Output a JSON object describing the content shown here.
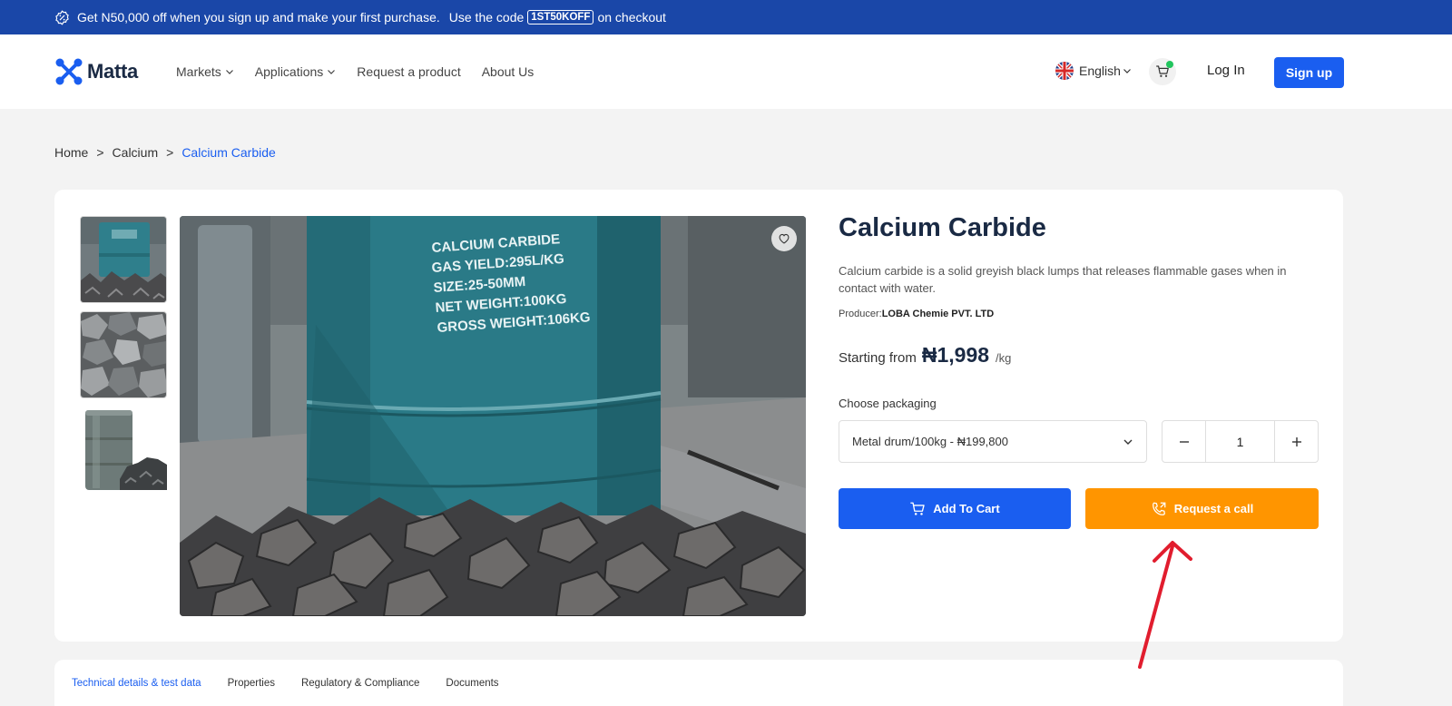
{
  "promo": {
    "text": "Get N50,000 off when you sign up and make your first purchase.",
    "code_prefix": "Use the code",
    "code": "1ST50KOFF",
    "code_suffix": "on checkout"
  },
  "header": {
    "brand": "Matta",
    "nav": [
      "Markets",
      "Applications",
      "Request a product",
      "About Us"
    ],
    "language": "English",
    "login": "Log In",
    "signup": "Sign up"
  },
  "breadcrumb": [
    "Home",
    "Calcium",
    "Calcium Carbide"
  ],
  "product": {
    "title": "Calcium Carbide",
    "description": "Calcium carbide is a solid greyish black lumps that releases flammable gases when in contact with water.",
    "producer_label": "Producer:",
    "producer": "LOBA Chemie PVT. LTD",
    "price_prefix": "Starting from",
    "price": "₦1,998",
    "price_unit": "/kg",
    "packaging_label": "Choose packaging",
    "packaging_selected": "Metal drum/100kg - ₦199,800",
    "quantity": "1",
    "add_to_cart": "Add To Cart",
    "request_call": "Request a call",
    "drum_label": [
      "CALCIUM CARBIDE",
      "GAS YIELD:295L/KG",
      "SIZE:25-50MM",
      "NET WEIGHT:100KG",
      "GROSS WEIGHT:106KG"
    ]
  },
  "tabs": [
    "Technical details & test data",
    "Properties",
    "Regulatory & Compliance",
    "Documents"
  ],
  "colors": {
    "promo_bg": "#1a47a8",
    "primary": "#1a5ef0",
    "orange": "#ff9500",
    "arrow": "#e11d2e"
  }
}
